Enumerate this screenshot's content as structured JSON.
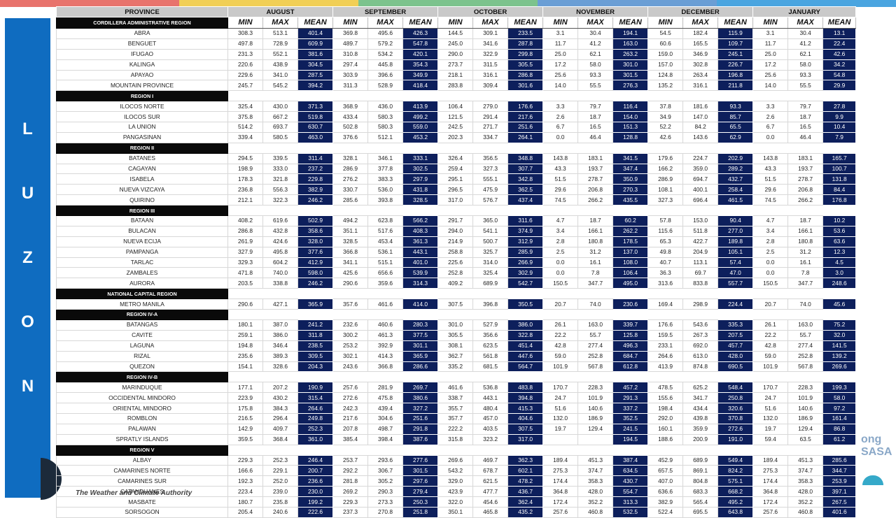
{
  "topbar_colors": [
    "#e8736c",
    "#f1cf56",
    "#7cc38d",
    "#6a9ed5",
    "#4aa5e0"
  ],
  "side_label": [
    "L",
    "U",
    "Z",
    "O",
    "N"
  ],
  "footer_text": "The Weather and Climate Authority",
  "logo_right": [
    "ong",
    "SASA"
  ],
  "table": {
    "province_header": "PROVINCE",
    "months": [
      "AUGUST",
      "SEPTEMBER",
      "OCTOBER",
      "NOVEMBER",
      "DECEMBER",
      "JANUARY"
    ],
    "sub_headers": [
      "MIN",
      "MAX",
      "MEAN"
    ],
    "rows": [
      {
        "type": "region",
        "name": "CORDILLERA ADMINISTRATIVE REGION"
      },
      {
        "type": "prov",
        "name": "ABRA",
        "v": [
          "308.3",
          "513.1",
          "401.4",
          "369.8",
          "495.6",
          "426.3",
          "144.5",
          "309.1",
          "233.5",
          "3.1",
          "30.4",
          "194.1",
          "54.5",
          "182.4",
          "115.9",
          "3.1",
          "30.4",
          "13.1"
        ]
      },
      {
        "type": "prov",
        "name": "BENGUET",
        "v": [
          "497.8",
          "728.9",
          "609.9",
          "489.7",
          "579.2",
          "547.8",
          "245.0",
          "341.6",
          "287.8",
          "11.7",
          "41.2",
          "163.0",
          "60.6",
          "165.5",
          "109.7",
          "11.7",
          "41.2",
          "22.4"
        ]
      },
      {
        "type": "prov",
        "name": "IFUGAO",
        "v": [
          "231.3",
          "552.1",
          "381.6",
          "310.8",
          "534.2",
          "420.1",
          "290.0",
          "322.9",
          "299.8",
          "25.0",
          "62.1",
          "263.2",
          "159.0",
          "346.9",
          "245.1",
          "25.0",
          "62.1",
          "42.6"
        ]
      },
      {
        "type": "prov",
        "name": "KALINGA",
        "v": [
          "220.6",
          "438.9",
          "304.5",
          "297.4",
          "445.8",
          "354.3",
          "273.7",
          "311.5",
          "305.5",
          "17.2",
          "58.0",
          "301.0",
          "157.0",
          "302.8",
          "226.7",
          "17.2",
          "58.0",
          "34.2"
        ]
      },
      {
        "type": "prov",
        "name": "APAYAO",
        "v": [
          "229.6",
          "341.0",
          "287.5",
          "303.9",
          "396.6",
          "349.9",
          "218.1",
          "316.1",
          "286.8",
          "25.6",
          "93.3",
          "301.5",
          "124.8",
          "263.4",
          "196.8",
          "25.6",
          "93.3",
          "54.8"
        ]
      },
      {
        "type": "prov",
        "name": "MOUNTAIN PROVINCE",
        "v": [
          "245.7",
          "545.2",
          "394.2",
          "311.3",
          "528.9",
          "418.4",
          "283.8",
          "309.4",
          "301.6",
          "14.0",
          "55.5",
          "276.3",
          "135.2",
          "316.1",
          "211.8",
          "14.0",
          "55.5",
          "29.9"
        ]
      },
      {
        "type": "region",
        "name": "REGION I"
      },
      {
        "type": "prov",
        "name": "ILOCOS NORTE",
        "v": [
          "325.4",
          "430.0",
          "371.3",
          "368.9",
          "436.0",
          "413.9",
          "106.4",
          "279.0",
          "176.6",
          "3.3",
          "79.7",
          "116.4",
          "37.8",
          "181.6",
          "93.3",
          "3.3",
          "79.7",
          "27.8"
        ]
      },
      {
        "type": "prov",
        "name": "ILOCOS SUR",
        "v": [
          "375.8",
          "667.2",
          "519.8",
          "433.4",
          "580.3",
          "499.2",
          "121.5",
          "291.4",
          "217.6",
          "2.6",
          "18.7",
          "154.0",
          "34.9",
          "147.0",
          "85.7",
          "2.6",
          "18.7",
          "9.9"
        ]
      },
      {
        "type": "prov",
        "name": "LA UNION",
        "v": [
          "514.2",
          "693.7",
          "630.7",
          "502.8",
          "580.3",
          "559.0",
          "242.5",
          "271.7",
          "251.6",
          "6.7",
          "16.5",
          "151.3",
          "52.2",
          "84.2",
          "65.5",
          "6.7",
          "16.5",
          "10.4"
        ]
      },
      {
        "type": "prov",
        "name": "PANGASINAN",
        "v": [
          "339.4",
          "580.5",
          "463.0",
          "376.6",
          "512.1",
          "453.2",
          "202.3",
          "334.7",
          "264.1",
          "0.0",
          "46.4",
          "128.8",
          "42.6",
          "143.6",
          "62.9",
          "0.0",
          "46.4",
          "7.9"
        ]
      },
      {
        "type": "region",
        "name": "REGION II"
      },
      {
        "type": "prov",
        "name": "BATANES",
        "v": [
          "294.5",
          "339.5",
          "311.4",
          "328.1",
          "346.1",
          "333.1",
          "326.4",
          "356.5",
          "348.8",
          "143.8",
          "183.1",
          "341.5",
          "179.6",
          "224.7",
          "202.9",
          "143.8",
          "183.1",
          "165.7"
        ]
      },
      {
        "type": "prov",
        "name": "CAGAYAN",
        "v": [
          "198.9",
          "333.0",
          "237.2",
          "286.9",
          "377.8",
          "302.5",
          "259.4",
          "327.3",
          "307.7",
          "43.3",
          "193.7",
          "347.4",
          "166.2",
          "359.0",
          "289.2",
          "43.3",
          "193.7",
          "100.7"
        ]
      },
      {
        "type": "prov",
        "name": "ISABELA",
        "v": [
          "178.3",
          "321.8",
          "229.8",
          "276.2",
          "383.3",
          "297.9",
          "295.1",
          "555.1",
          "342.8",
          "51.5",
          "278.7",
          "350.9",
          "286.9",
          "694.7",
          "432.7",
          "51.5",
          "278.7",
          "131.8"
        ]
      },
      {
        "type": "prov",
        "name": "NUEVA VIZCAYA",
        "v": [
          "236.8",
          "556.3",
          "382.9",
          "330.7",
          "536.0",
          "431.8",
          "296.5",
          "475.9",
          "362.5",
          "29.6",
          "206.8",
          "270.3",
          "108.1",
          "400.1",
          "258.4",
          "29.6",
          "206.8",
          "84.4"
        ]
      },
      {
        "type": "prov",
        "name": "QUIRINO",
        "v": [
          "212.1",
          "322.3",
          "246.2",
          "285.6",
          "393.8",
          "328.5",
          "317.0",
          "576.7",
          "437.4",
          "74.5",
          "266.2",
          "435.5",
          "327.3",
          "696.4",
          "461.5",
          "74.5",
          "266.2",
          "176.8"
        ]
      },
      {
        "type": "region",
        "name": "REGION III"
      },
      {
        "type": "prov",
        "name": "BATAAN",
        "v": [
          "408.2",
          "619.6",
          "502.9",
          "494.2",
          "623.8",
          "566.2",
          "291.7",
          "365.0",
          "311.6",
          "4.7",
          "18.7",
          "60.2",
          "57.8",
          "153.0",
          "90.4",
          "4.7",
          "18.7",
          "10.2"
        ]
      },
      {
        "type": "prov",
        "name": "BULACAN",
        "v": [
          "286.8",
          "432.8",
          "358.6",
          "351.1",
          "517.6",
          "408.3",
          "294.0",
          "541.1",
          "374.9",
          "3.4",
          "166.1",
          "262.2",
          "115.6",
          "511.8",
          "277.0",
          "3.4",
          "166.1",
          "53.6"
        ]
      },
      {
        "type": "prov",
        "name": "NUEVA ECIJA",
        "v": [
          "261.9",
          "424.6",
          "328.0",
          "328.5",
          "453.4",
          "361.3",
          "214.9",
          "500.7",
          "312.9",
          "2.8",
          "180.8",
          "178.5",
          "65.3",
          "422.7",
          "189.8",
          "2.8",
          "180.8",
          "63.6"
        ]
      },
      {
        "type": "prov",
        "name": "PAMPANGA",
        "v": [
          "327.9",
          "495.8",
          "377.6",
          "366.8",
          "536.1",
          "443.1",
          "258.8",
          "325.7",
          "285.9",
          "2.5",
          "31.2",
          "137.0",
          "49.8",
          "204.9",
          "105.1",
          "2.5",
          "31.2",
          "12.3"
        ]
      },
      {
        "type": "prov",
        "name": "TARLAC",
        "v": [
          "329.3",
          "604.2",
          "412.9",
          "341.1",
          "515.1",
          "401.0",
          "225.6",
          "314.0",
          "266.9",
          "0.0",
          "16.1",
          "108.0",
          "40.7",
          "113.1",
          "57.4",
          "0.0",
          "16.1",
          "4.5"
        ]
      },
      {
        "type": "prov",
        "name": "ZAMBALES",
        "v": [
          "471.8",
          "740.0",
          "598.0",
          "425.6",
          "656.6",
          "539.9",
          "252.8",
          "325.4",
          "302.9",
          "0.0",
          "7.8",
          "106.4",
          "36.3",
          "69.7",
          "47.0",
          "0.0",
          "7.8",
          "3.0"
        ]
      },
      {
        "type": "prov",
        "name": "AURORA",
        "v": [
          "203.5",
          "338.8",
          "246.2",
          "290.6",
          "359.6",
          "314.3",
          "409.2",
          "689.9",
          "542.7",
          "150.5",
          "347.7",
          "495.0",
          "313.6",
          "833.8",
          "557.7",
          "150.5",
          "347.7",
          "248.6"
        ]
      },
      {
        "type": "region",
        "name": "NATIONAL CAPITAL REGION"
      },
      {
        "type": "prov",
        "name": "METRO MANILA",
        "v": [
          "290.6",
          "427.1",
          "365.9",
          "357.6",
          "461.6",
          "414.0",
          "307.5",
          "396.8",
          "350.5",
          "20.7",
          "74.0",
          "230.6",
          "169.4",
          "298.9",
          "224.4",
          "20.7",
          "74.0",
          "45.6"
        ]
      },
      {
        "type": "region",
        "name": "REGION IV-A"
      },
      {
        "type": "prov",
        "name": "BATANGAS",
        "v": [
          "180.1",
          "387.0",
          "241.2",
          "232.6",
          "460.6",
          "280.3",
          "301.0",
          "527.9",
          "386.0",
          "26.1",
          "163.0",
          "339.7",
          "176.6",
          "543.6",
          "335.3",
          "26.1",
          "163.0",
          "75.2"
        ]
      },
      {
        "type": "prov",
        "name": "CAVITE",
        "v": [
          "259.1",
          "386.0",
          "311.8",
          "300.2",
          "461.3",
          "377.5",
          "305.5",
          "356.6",
          "322.8",
          "22.2",
          "55.7",
          "125.8",
          "159.5",
          "267.3",
          "207.5",
          "22.2",
          "55.7",
          "32.0"
        ]
      },
      {
        "type": "prov",
        "name": "LAGUNA",
        "v": [
          "194.8",
          "346.4",
          "238.5",
          "253.2",
          "392.9",
          "301.1",
          "308.1",
          "623.5",
          "451.4",
          "42.8",
          "277.4",
          "496.3",
          "233.1",
          "692.0",
          "457.7",
          "42.8",
          "277.4",
          "141.5"
        ]
      },
      {
        "type": "prov",
        "name": "RIZAL",
        "v": [
          "235.6",
          "389.3",
          "309.5",
          "302.1",
          "414.3",
          "365.9",
          "362.7",
          "561.8",
          "447.6",
          "59.0",
          "252.8",
          "684.7",
          "264.6",
          "613.0",
          "428.0",
          "59.0",
          "252.8",
          "139.2"
        ]
      },
      {
        "type": "prov",
        "name": "QUEZON",
        "v": [
          "154.1",
          "328.6",
          "204.3",
          "243.6",
          "366.8",
          "286.6",
          "335.2",
          "681.5",
          "564.7",
          "101.9",
          "567.8",
          "612.8",
          "413.9",
          "874.8",
          "690.5",
          "101.9",
          "567.8",
          "269.6"
        ]
      },
      {
        "type": "region",
        "name": "REGION IV-B"
      },
      {
        "type": "prov",
        "name": "MARINDUQUE",
        "v": [
          "177.1",
          "207.2",
          "190.9",
          "257.6",
          "281.9",
          "269.7",
          "461.6",
          "536.8",
          "483.8",
          "170.7",
          "228.3",
          "457.2",
          "478.5",
          "625.2",
          "548.4",
          "170.7",
          "228.3",
          "199.3"
        ]
      },
      {
        "type": "prov",
        "name": "OCCIDENTAL MINDORO",
        "v": [
          "223.9",
          "430.2",
          "315.4",
          "272.6",
          "475.8",
          "380.6",
          "338.7",
          "443.1",
          "394.8",
          "24.7",
          "101.9",
          "291.3",
          "155.6",
          "341.7",
          "250.8",
          "24.7",
          "101.9",
          "58.0"
        ]
      },
      {
        "type": "prov",
        "name": "ORIENTAL MINDORO",
        "v": [
          "175.8",
          "384.3",
          "264.6",
          "242.3",
          "439.4",
          "327.2",
          "355.7",
          "480.4",
          "415.3",
          "51.6",
          "140.6",
          "337.2",
          "198.4",
          "434.4",
          "320.6",
          "51.6",
          "140.6",
          "97.2"
        ]
      },
      {
        "type": "prov",
        "name": "ROMBLON",
        "v": [
          "216.5",
          "296.4",
          "249.8",
          "217.6",
          "304.6",
          "251.6",
          "357.7",
          "457.0",
          "404.6",
          "132.0",
          "186.9",
          "352.5",
          "292.0",
          "439.8",
          "370.8",
          "132.0",
          "186.9",
          "161.4"
        ]
      },
      {
        "type": "prov",
        "name": "PALAWAN",
        "v": [
          "142.9",
          "409.7",
          "252.3",
          "207.8",
          "498.7",
          "291.8",
          "222.2",
          "403.5",
          "307.5",
          "19.7",
          "129.4",
          "241.5",
          "160.1",
          "359.9",
          "272.6",
          "19.7",
          "129.4",
          "86.8"
        ]
      },
      {
        "type": "prov",
        "name": "SPRATLY ISLANDS",
        "v": [
          "359.5",
          "368.4",
          "361.0",
          "385.4",
          "398.4",
          "387.6",
          "315.8",
          "323.2",
          "317.0",
          "",
          "",
          "194.5",
          "188.6",
          "200.9",
          "191.0",
          "59.4",
          "63.5",
          "61.2"
        ]
      },
      {
        "type": "region",
        "name": "REGION V"
      },
      {
        "type": "prov",
        "name": "ALBAY",
        "v": [
          "229.3",
          "252.3",
          "246.4",
          "253.7",
          "293.6",
          "277.6",
          "269.6",
          "469.7",
          "362.3",
          "189.4",
          "451.3",
          "387.4",
          "452.9",
          "689.9",
          "549.4",
          "189.4",
          "451.3",
          "285.6"
        ]
      },
      {
        "type": "prov",
        "name": "CAMARINES NORTE",
        "v": [
          "166.6",
          "229.1",
          "200.7",
          "292.2",
          "306.7",
          "301.5",
          "543.2",
          "678.7",
          "602.1",
          "275.3",
          "374.7",
          "634.5",
          "657.5",
          "869.1",
          "824.2",
          "275.3",
          "374.7",
          "344.7"
        ]
      },
      {
        "type": "prov",
        "name": "CAMARINES SUR",
        "v": [
          "192.3",
          "252.0",
          "236.6",
          "281.8",
          "305.2",
          "297.6",
          "329.0",
          "621.5",
          "478.2",
          "174.4",
          "358.3",
          "430.7",
          "407.0",
          "804.8",
          "575.1",
          "174.4",
          "358.3",
          "253.9"
        ]
      },
      {
        "type": "prov",
        "name": "CATANDUANES",
        "v": [
          "223.4",
          "239.0",
          "230.0",
          "269.2",
          "290.3",
          "279.4",
          "423.9",
          "477.7",
          "436.7",
          "364.8",
          "428.0",
          "554.7",
          "636.6",
          "683.3",
          "668.2",
          "364.8",
          "428.0",
          "397.1"
        ]
      },
      {
        "type": "prov",
        "name": "MASBATE",
        "v": [
          "180.7",
          "235.8",
          "199.2",
          "229.3",
          "273.3",
          "250.3",
          "322.0",
          "454.6",
          "362.4",
          "172.4",
          "352.2",
          "313.3",
          "382.9",
          "565.4",
          "495.2",
          "172.4",
          "352.2",
          "267.5"
        ]
      },
      {
        "type": "prov",
        "name": "SORSOGON",
        "v": [
          "205.4",
          "240.6",
          "222.6",
          "237.3",
          "270.8",
          "251.8",
          "350.1",
          "465.8",
          "435.2",
          "257.6",
          "460.8",
          "532.5",
          "522.4",
          "695.5",
          "643.8",
          "257.6",
          "460.8",
          "401.6"
        ]
      }
    ]
  }
}
